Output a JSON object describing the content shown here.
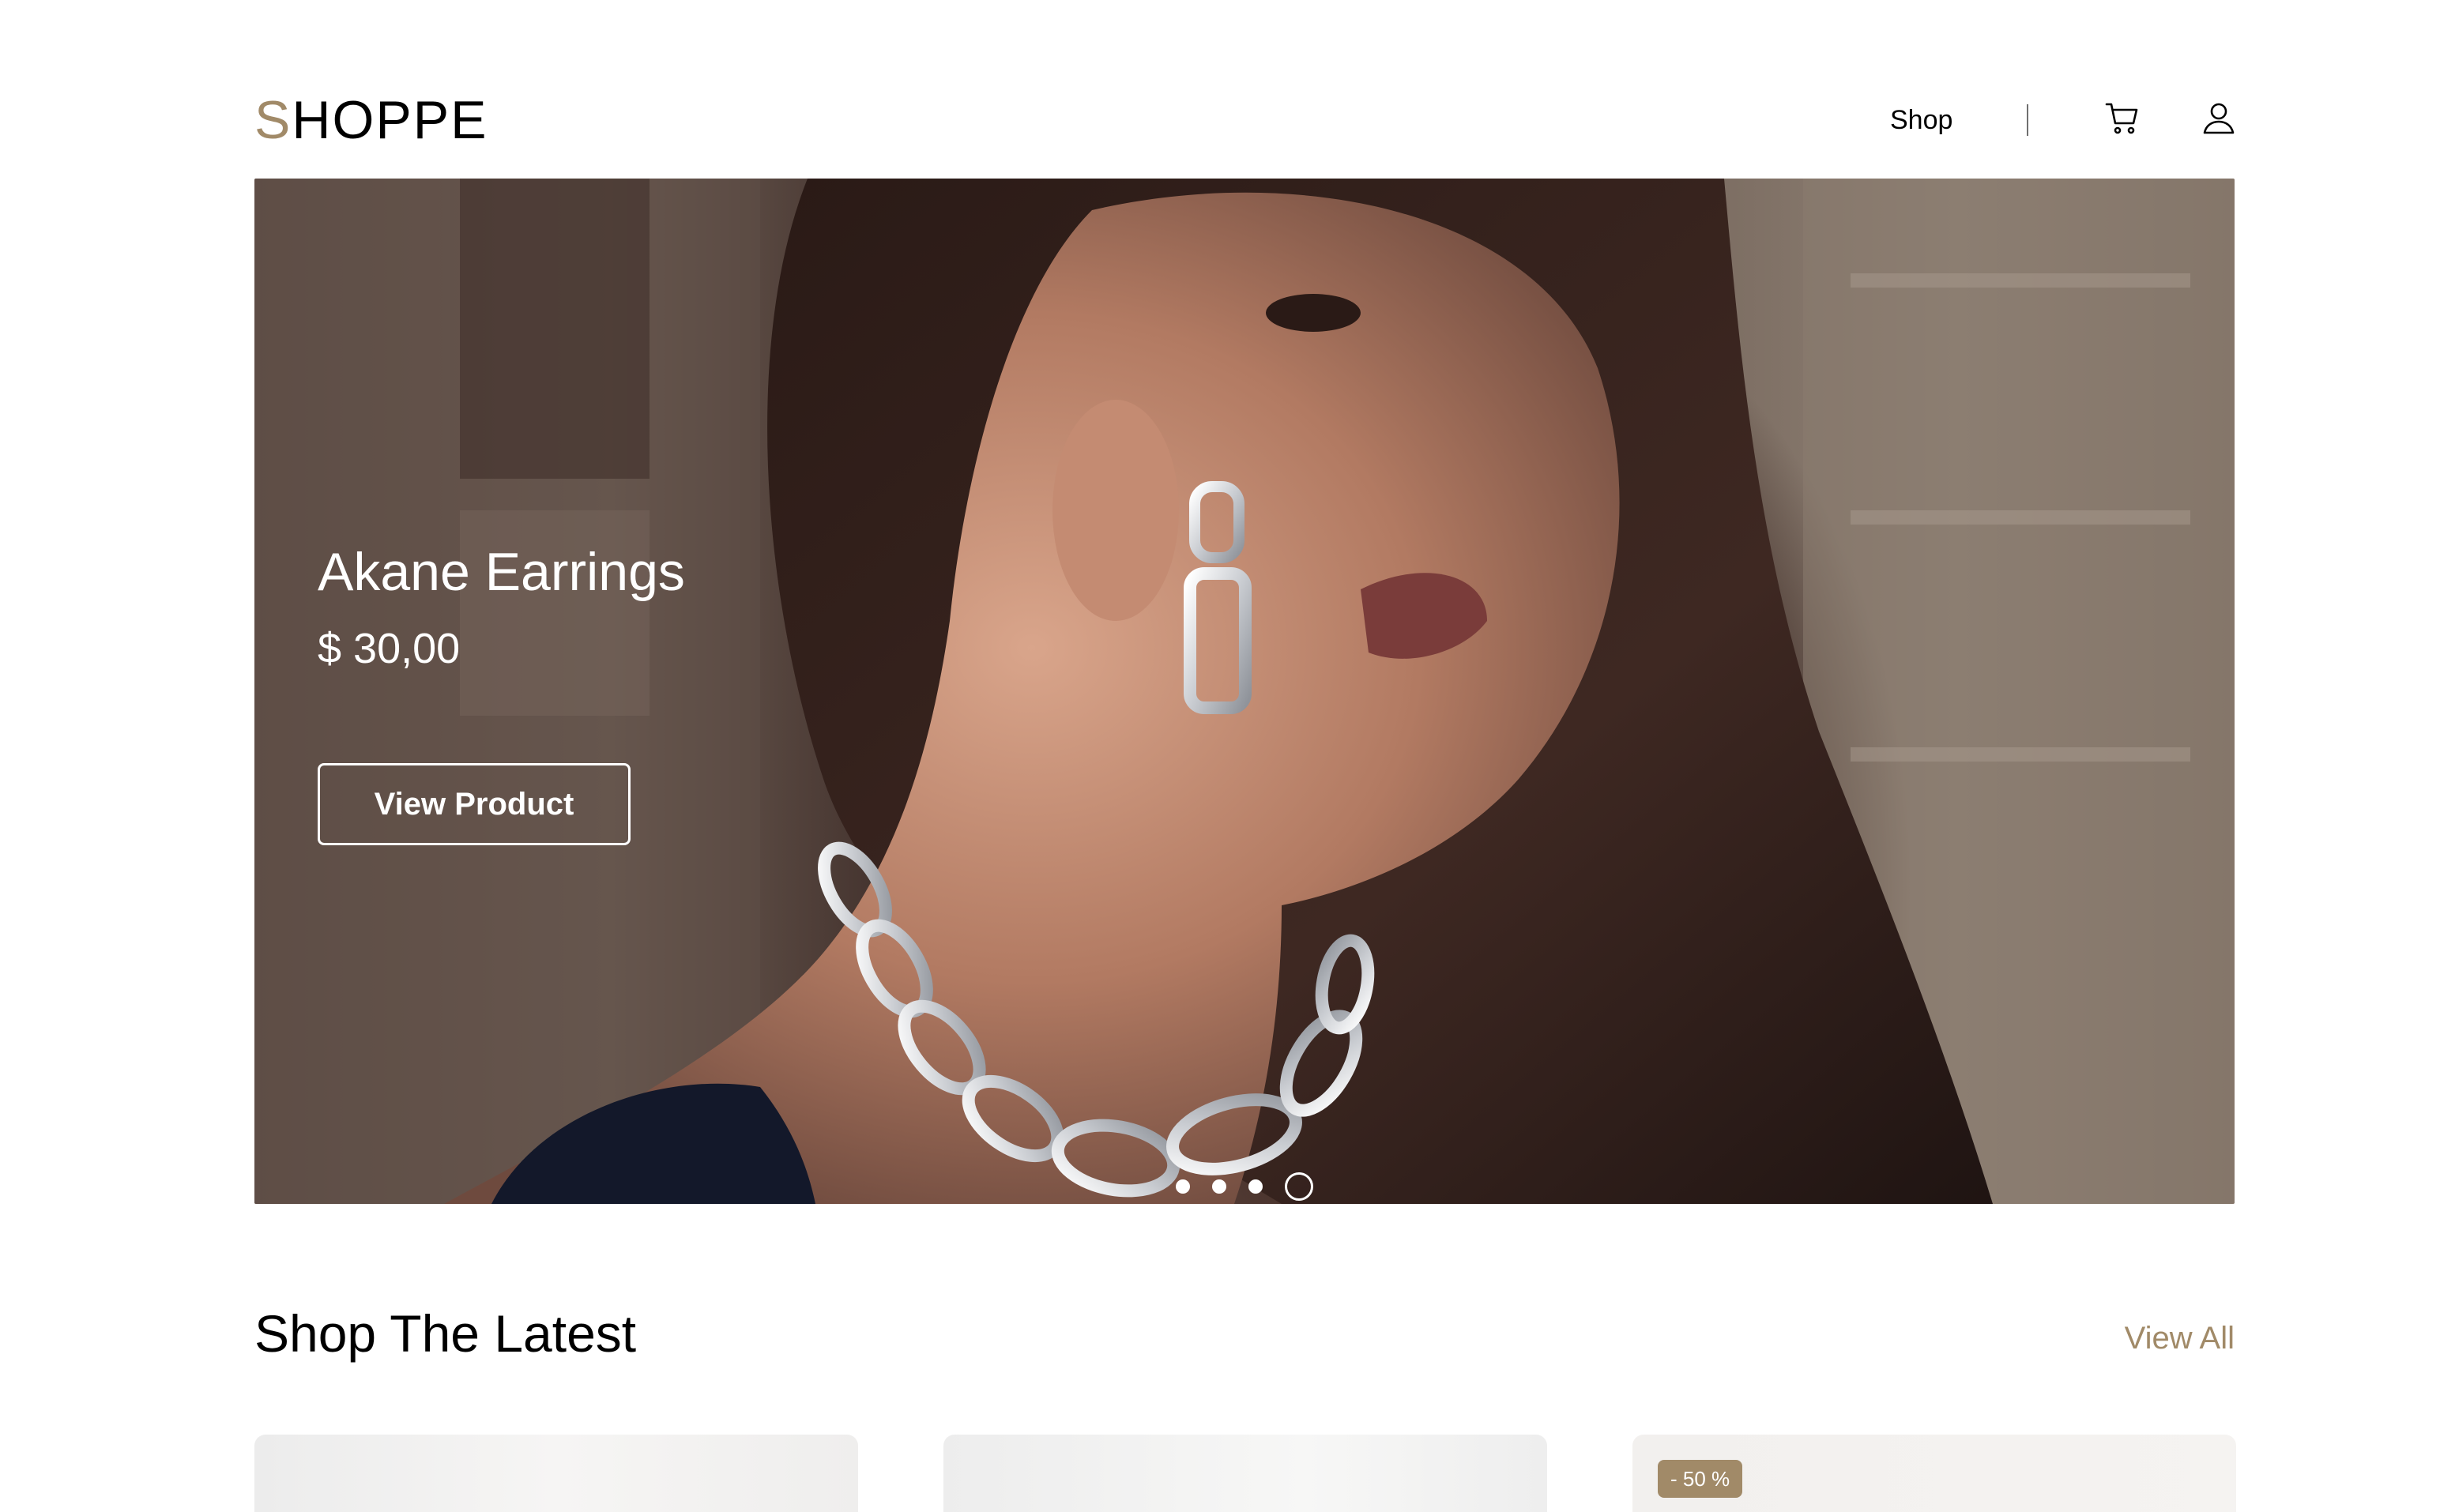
{
  "header": {
    "logo_first": "S",
    "logo_rest": "HOPPE",
    "nav_shop": "Shop",
    "icons": [
      "cart-icon",
      "user-icon"
    ]
  },
  "hero": {
    "title": "Akane Earrings",
    "price": "$ 30,00",
    "button": "View Product",
    "slides_total": 4,
    "active_slide": 4
  },
  "section": {
    "title": "Shop The Latest",
    "view_all": "View All"
  },
  "products": [
    {
      "badge": ""
    },
    {
      "badge": ""
    },
    {
      "badge": "- 50 %"
    }
  ],
  "colors": {
    "accent": "#a18a68",
    "text": "#000000",
    "background": "#ffffff"
  }
}
